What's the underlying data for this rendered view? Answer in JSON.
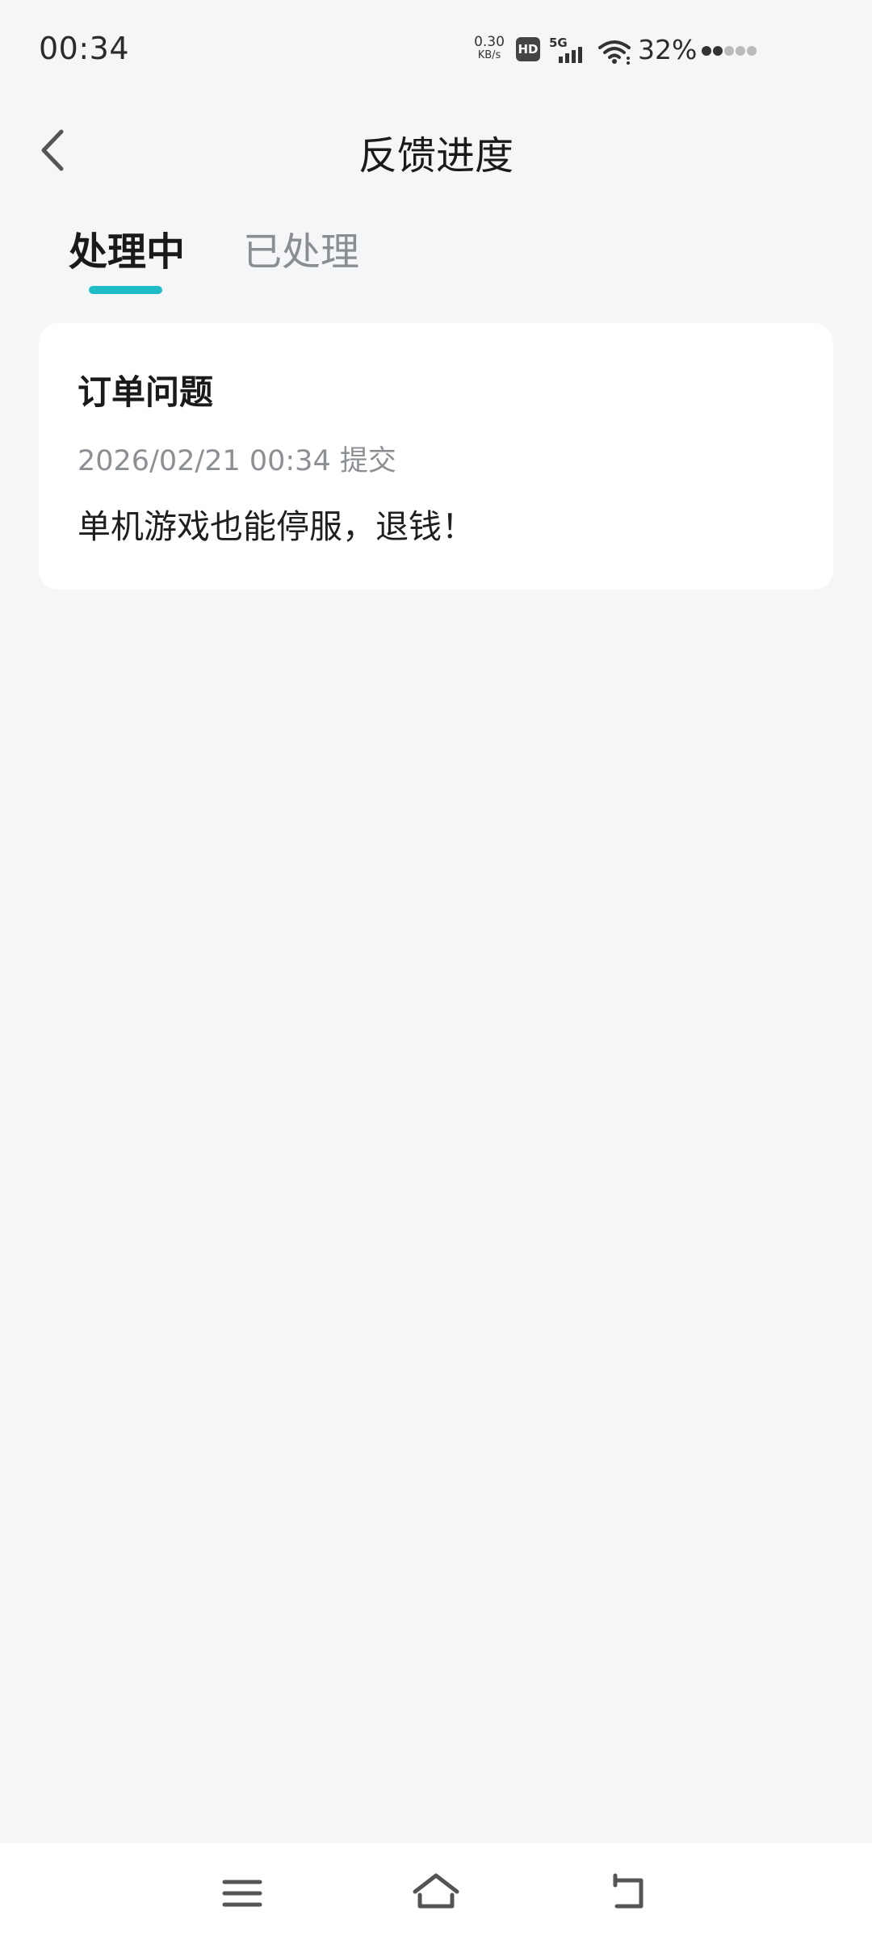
{
  "status_bar": {
    "time": "00:34",
    "net_speed_value": "0.30",
    "net_speed_unit": "KB/s",
    "hd_label": "HD",
    "network_type": "5G",
    "battery": "32%",
    "icons": [
      "hd-icon",
      "signal-5g-icon",
      "wifi-icon",
      "battery-dots-icon"
    ]
  },
  "header": {
    "title": "反馈进度",
    "back_icon": "chevron-left-icon"
  },
  "tabs": [
    {
      "label": "处理中",
      "active": true
    },
    {
      "label": "已处理",
      "active": false
    }
  ],
  "feedback_list": [
    {
      "category": "订单问题",
      "submitted": "2026/02/21 00:34 提交",
      "content": "单机游戏也能停服，退钱！"
    }
  ],
  "nav_bar": {
    "icons": [
      "menu-icon",
      "home-icon",
      "back-icon"
    ]
  },
  "colors": {
    "accent": "#1fbcc7",
    "background": "#f5f6f8",
    "card": "#ffffff",
    "muted_text": "#8c8f94"
  }
}
